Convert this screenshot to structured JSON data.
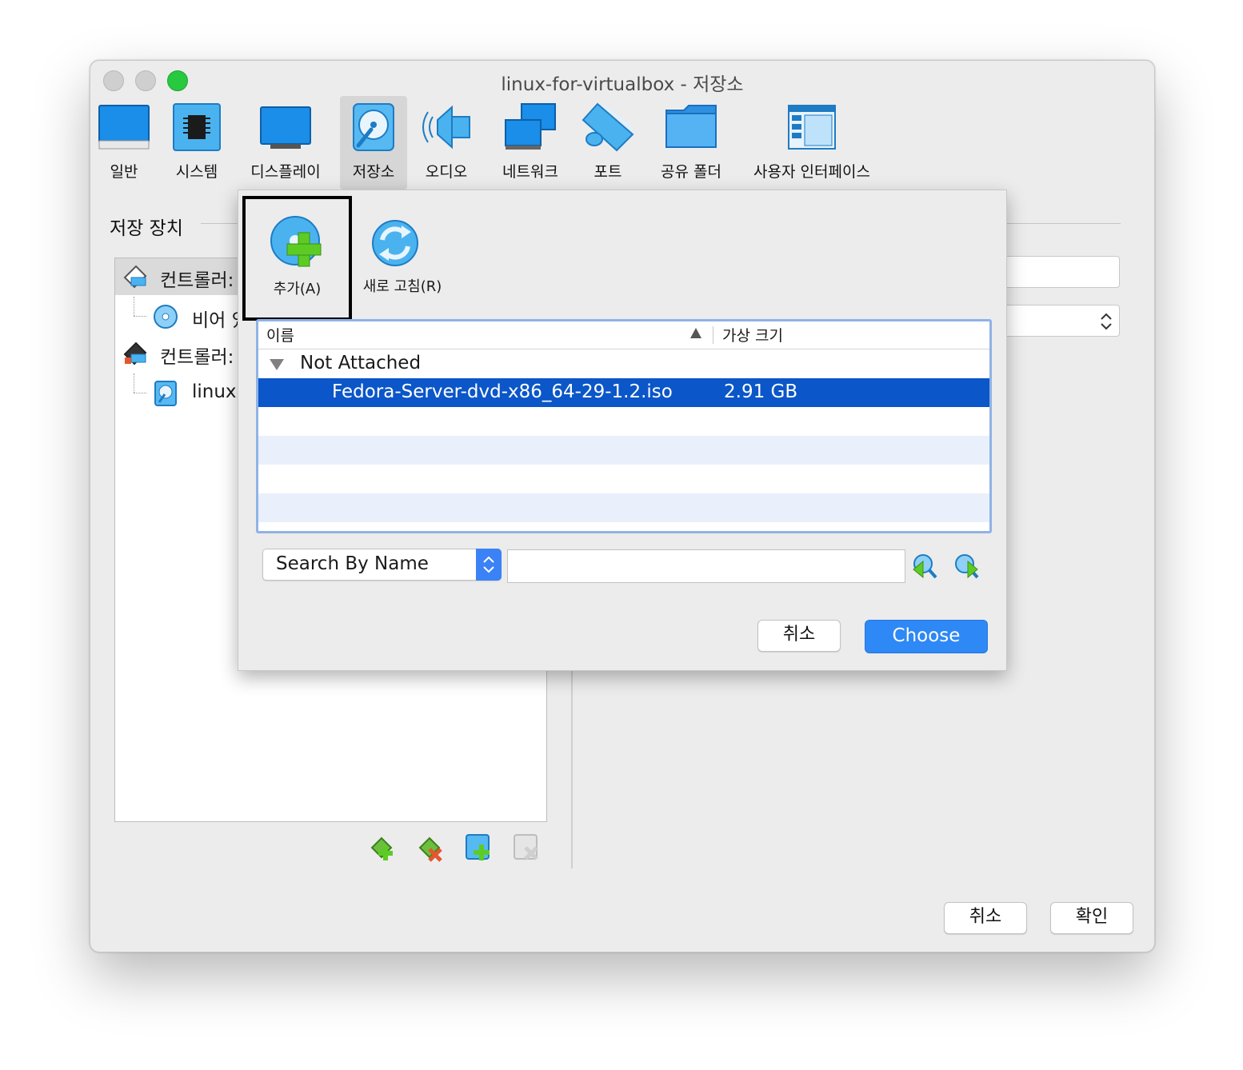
{
  "window": {
    "title": "linux-for-virtualbox - 저장소"
  },
  "toolbar": {
    "items": [
      {
        "label": "일반",
        "icon": "general-monitor-icon"
      },
      {
        "label": "시스템",
        "icon": "system-chip-icon"
      },
      {
        "label": "디스플레이",
        "icon": "display-monitor-icon"
      },
      {
        "label": "저장소",
        "icon": "storage-disk-icon",
        "selected": true
      },
      {
        "label": "오디오",
        "icon": "audio-speaker-icon"
      },
      {
        "label": "네트워크",
        "icon": "network-icon"
      },
      {
        "label": "포트",
        "icon": "ports-icon"
      },
      {
        "label": "공유 폴더",
        "icon": "shared-folder-icon"
      },
      {
        "label": "사용자 인터페이스",
        "icon": "user-interface-icon"
      }
    ]
  },
  "storage": {
    "section_title": "저장 장치",
    "tree": [
      {
        "label": "컨트롤러:",
        "type": "controller",
        "highlighted": true
      },
      {
        "label": "비어 있",
        "type": "optical-disk"
      },
      {
        "label": "컨트롤러:",
        "type": "controller"
      },
      {
        "label": "linux",
        "type": "hard-disk"
      }
    ]
  },
  "chooser": {
    "tools": {
      "add_label": "추가(A)",
      "refresh_label": "새로 고침(R)"
    },
    "columns": {
      "name": "이름",
      "size": "가상 크기"
    },
    "group": {
      "label": "Not Attached"
    },
    "items": [
      {
        "name": "Fedora-Server-dvd-x86_64-29-1.2.iso",
        "size": "2.91 GB",
        "selected": true
      }
    ],
    "search": {
      "mode": "Search By Name",
      "value": ""
    },
    "buttons": {
      "cancel": "취소",
      "choose": "Choose"
    }
  },
  "footer": {
    "cancel": "취소",
    "ok": "확인"
  },
  "colors": {
    "selection": "#0b56c8",
    "accent_button": "#2e88f5",
    "close_green": "#27c93f"
  }
}
